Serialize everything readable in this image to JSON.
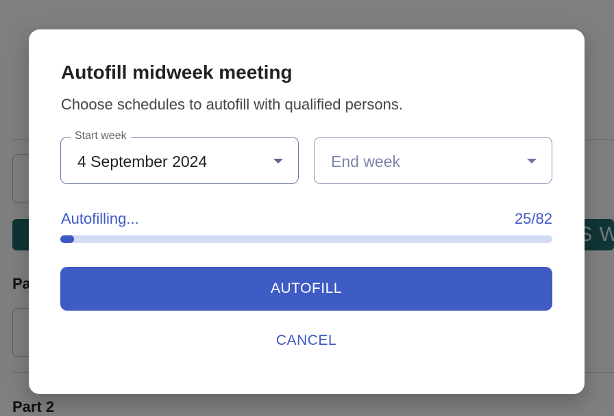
{
  "background": {
    "section_label_partial": "Pa",
    "section_label": "Part 2",
    "banner_text_partial": "YS W"
  },
  "dialog": {
    "title": "Autofill midweek meeting",
    "subtitle": "Choose schedules to autofill with qualified persons.",
    "start_week": {
      "label": "Start week",
      "value": "4 September 2024"
    },
    "end_week": {
      "placeholder": "End week"
    },
    "progress": {
      "label": "Autofilling...",
      "count_text": "25/82",
      "current": 25,
      "total": 82
    },
    "autofill_button": "AUTOFILL",
    "cancel_button": "CANCEL"
  },
  "colors": {
    "accent": "#3f5bc4",
    "progress_track": "#d3dbf5",
    "banner": "#1f6a6e"
  }
}
